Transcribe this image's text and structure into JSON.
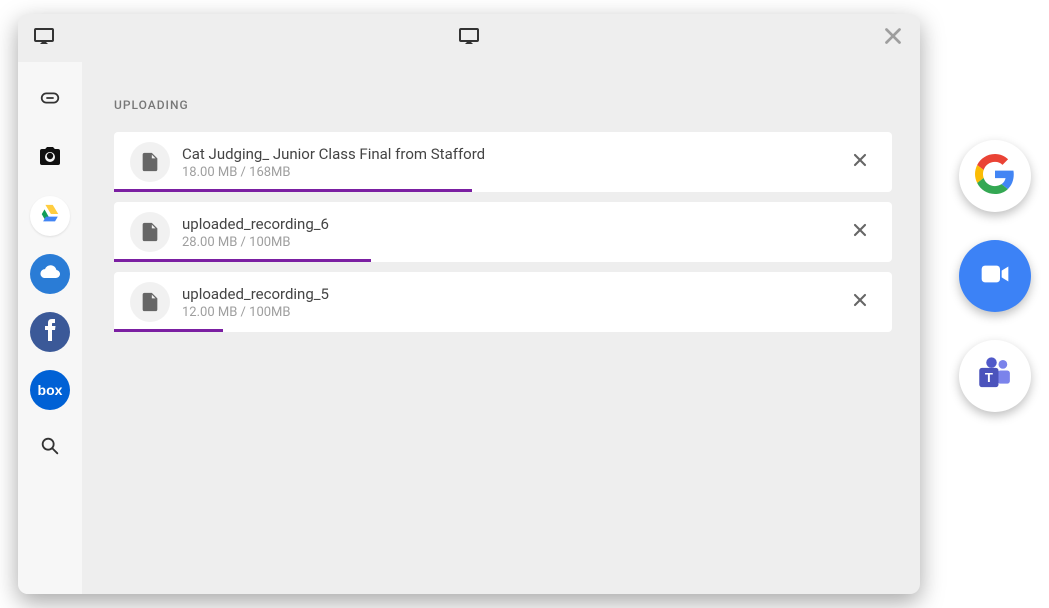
{
  "section_title": "UPLOADING",
  "uploads": [
    {
      "name": "Cat Judging_ Junior Class Final from Stafford",
      "meta": "18.00 MB / 168MB",
      "progress_pct": 46
    },
    {
      "name": "uploaded_recording_6",
      "meta": "28.00 MB / 100MB",
      "progress_pct": 33
    },
    {
      "name": "uploaded_recording_5",
      "meta": "12.00 MB / 100MB",
      "progress_pct": 14
    }
  ],
  "sidebar": {
    "items": [
      {
        "name": "link"
      },
      {
        "name": "camera"
      },
      {
        "name": "google-drive"
      },
      {
        "name": "onedrive"
      },
      {
        "name": "facebook"
      },
      {
        "name": "box"
      },
      {
        "name": "search"
      }
    ]
  },
  "external": {
    "items": [
      {
        "name": "google"
      },
      {
        "name": "zoom"
      },
      {
        "name": "teams"
      }
    ]
  }
}
